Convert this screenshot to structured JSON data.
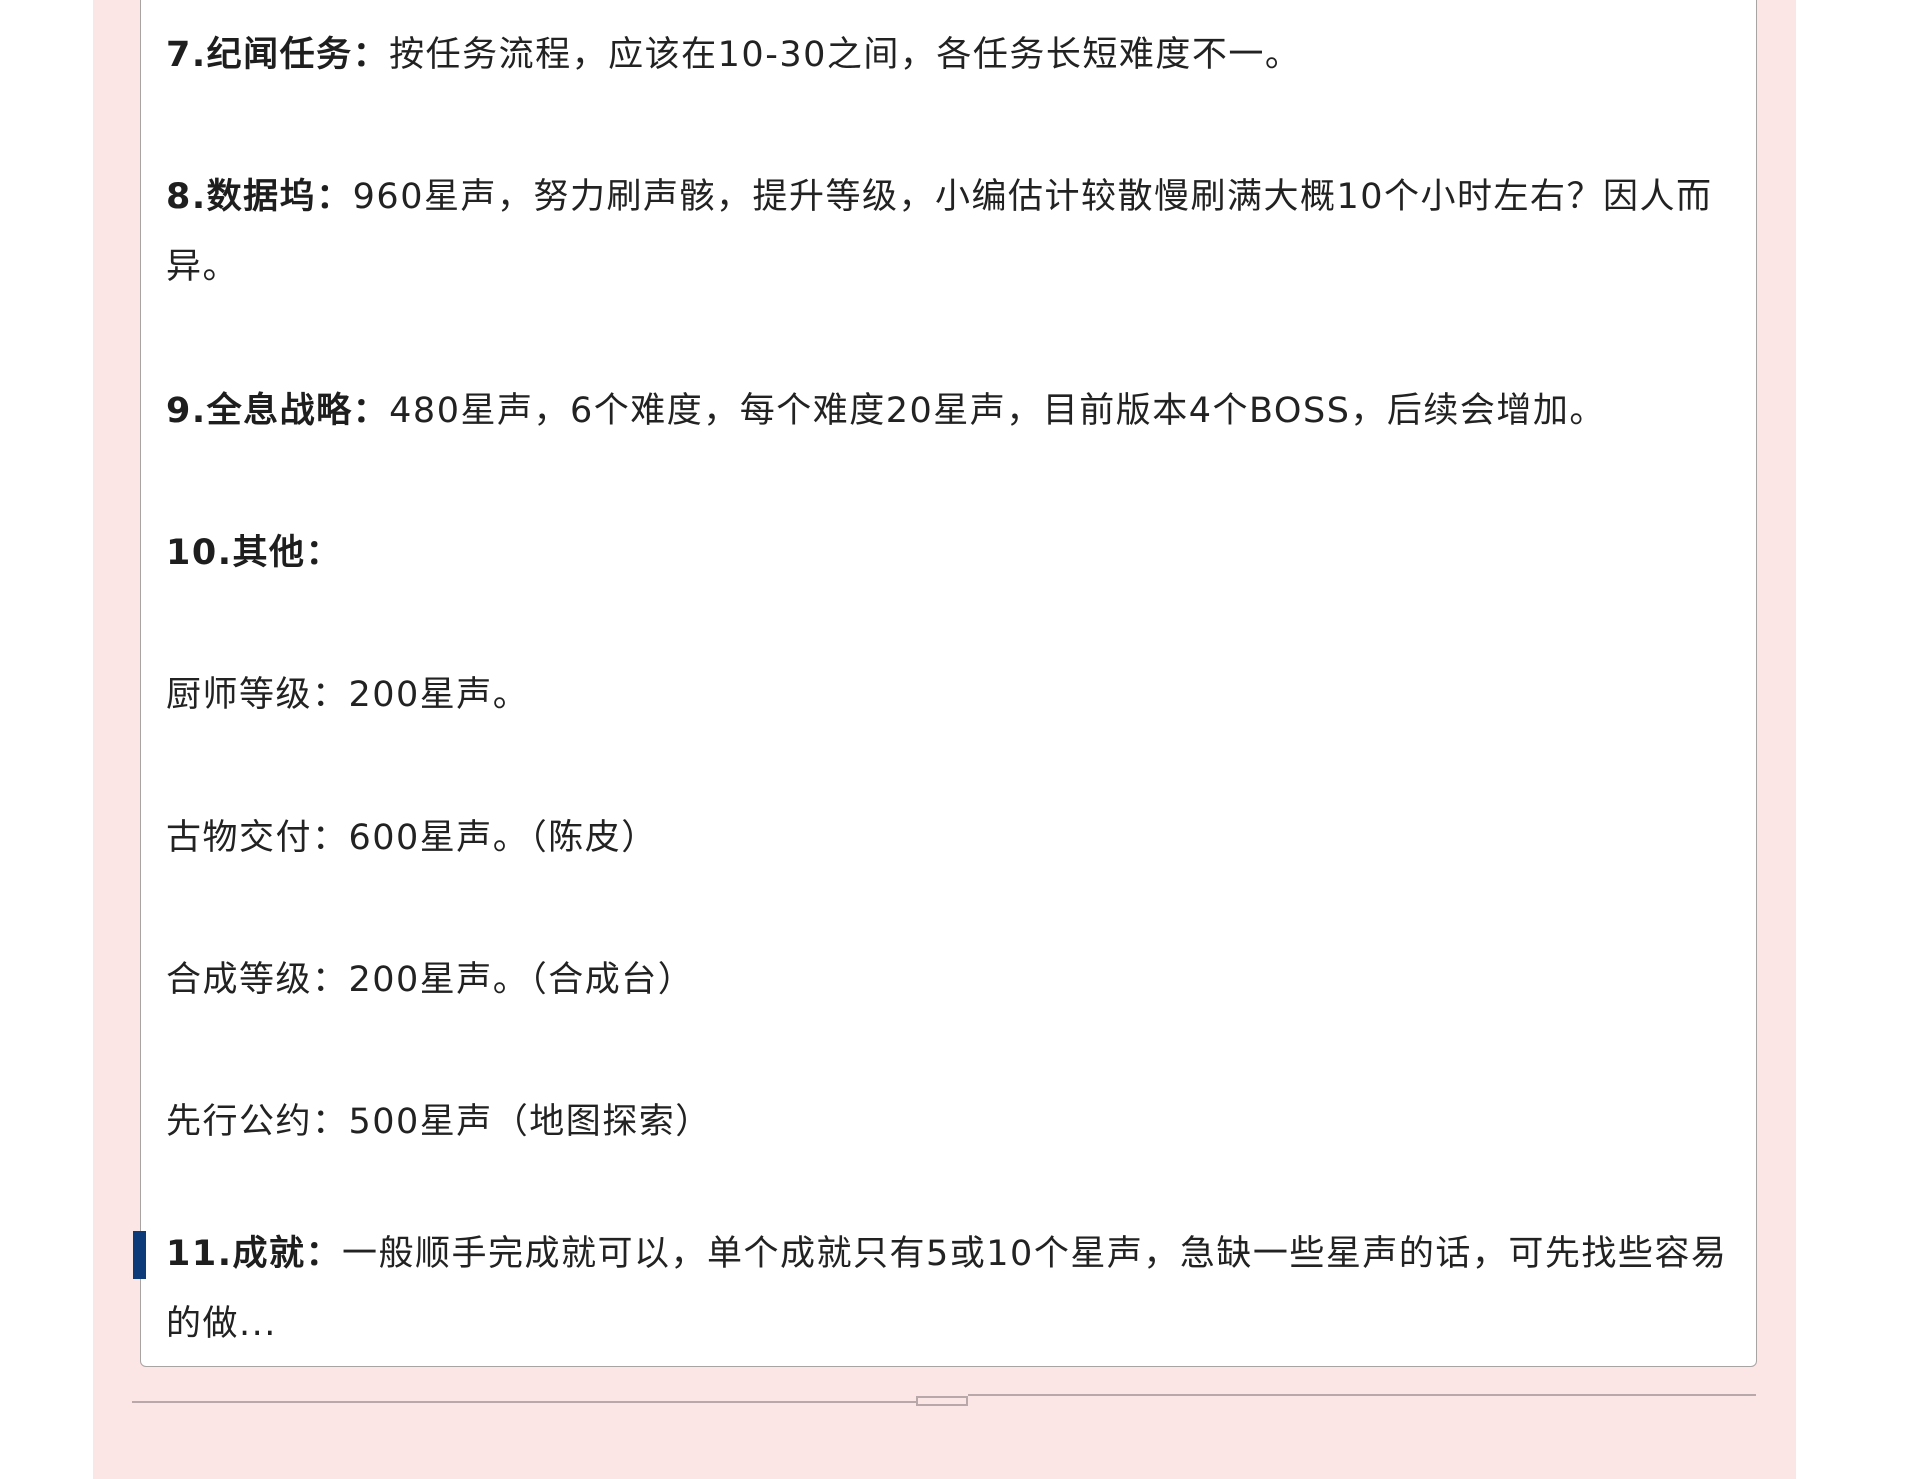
{
  "items": [
    {
      "label": "7.纪闻任务：",
      "text": "按任务流程，应该在10-30之间，各任务长短难度不一。"
    },
    {
      "label": "8.数据坞：",
      "text": "960星声，努力刷声骸，提升等级，小编估计较散慢刷满大概10个小时左右？因人而异。"
    },
    {
      "label": "9.全息战略：",
      "text": "480星声，6个难度，每个难度20星声，目前版本4个BOSS，后续会增加。"
    },
    {
      "label": "10.其他：",
      "text": ""
    },
    {
      "label": "",
      "text": "厨师等级：200星声。"
    },
    {
      "label": "",
      "text": "古物交付：600星声。（陈皮）"
    },
    {
      "label": "",
      "text": "合成等级：200星声。（合成台）"
    },
    {
      "label": "",
      "text": "先行公约：500星声（地图探索）"
    },
    {
      "label": "11.成就：",
      "text": "一般顺手完成就可以，单个成就只有5或10个星声，急缺一些星声的话，可先找些容易的做..."
    }
  ],
  "colors": {
    "panel_background": "#fce5e5",
    "card_border": "#a9a4a4",
    "marker": "#0d3b7a"
  }
}
